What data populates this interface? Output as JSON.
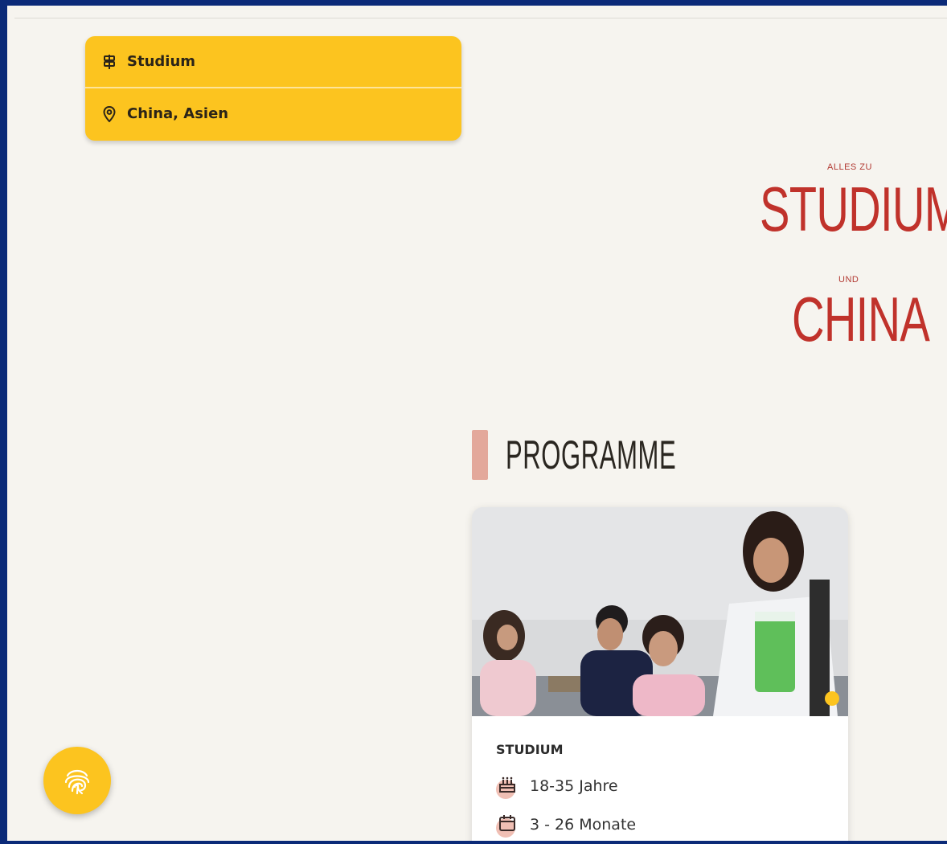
{
  "filter": {
    "items": [
      {
        "label": "Studium",
        "icon": "signpost-icon"
      },
      {
        "label": "China, Asien",
        "icon": "location-pin-icon"
      }
    ],
    "background": "#fcc41f"
  },
  "hero": {
    "prefix_small": "ALLES ZU",
    "word_1": "STUDIUM",
    "connector_small": "UND",
    "word_2": "CHINA",
    "color": "#c0322b"
  },
  "section": {
    "title": "PROGRAMME",
    "accent": "#e3a89b"
  },
  "program_card": {
    "title": "STUDIUM",
    "age": "18-35 Jahre",
    "duration": "3 - 26 Monate",
    "image": "students-photo"
  },
  "fab": {
    "icon": "fingerprint-icon",
    "color": "#fcc41f"
  }
}
